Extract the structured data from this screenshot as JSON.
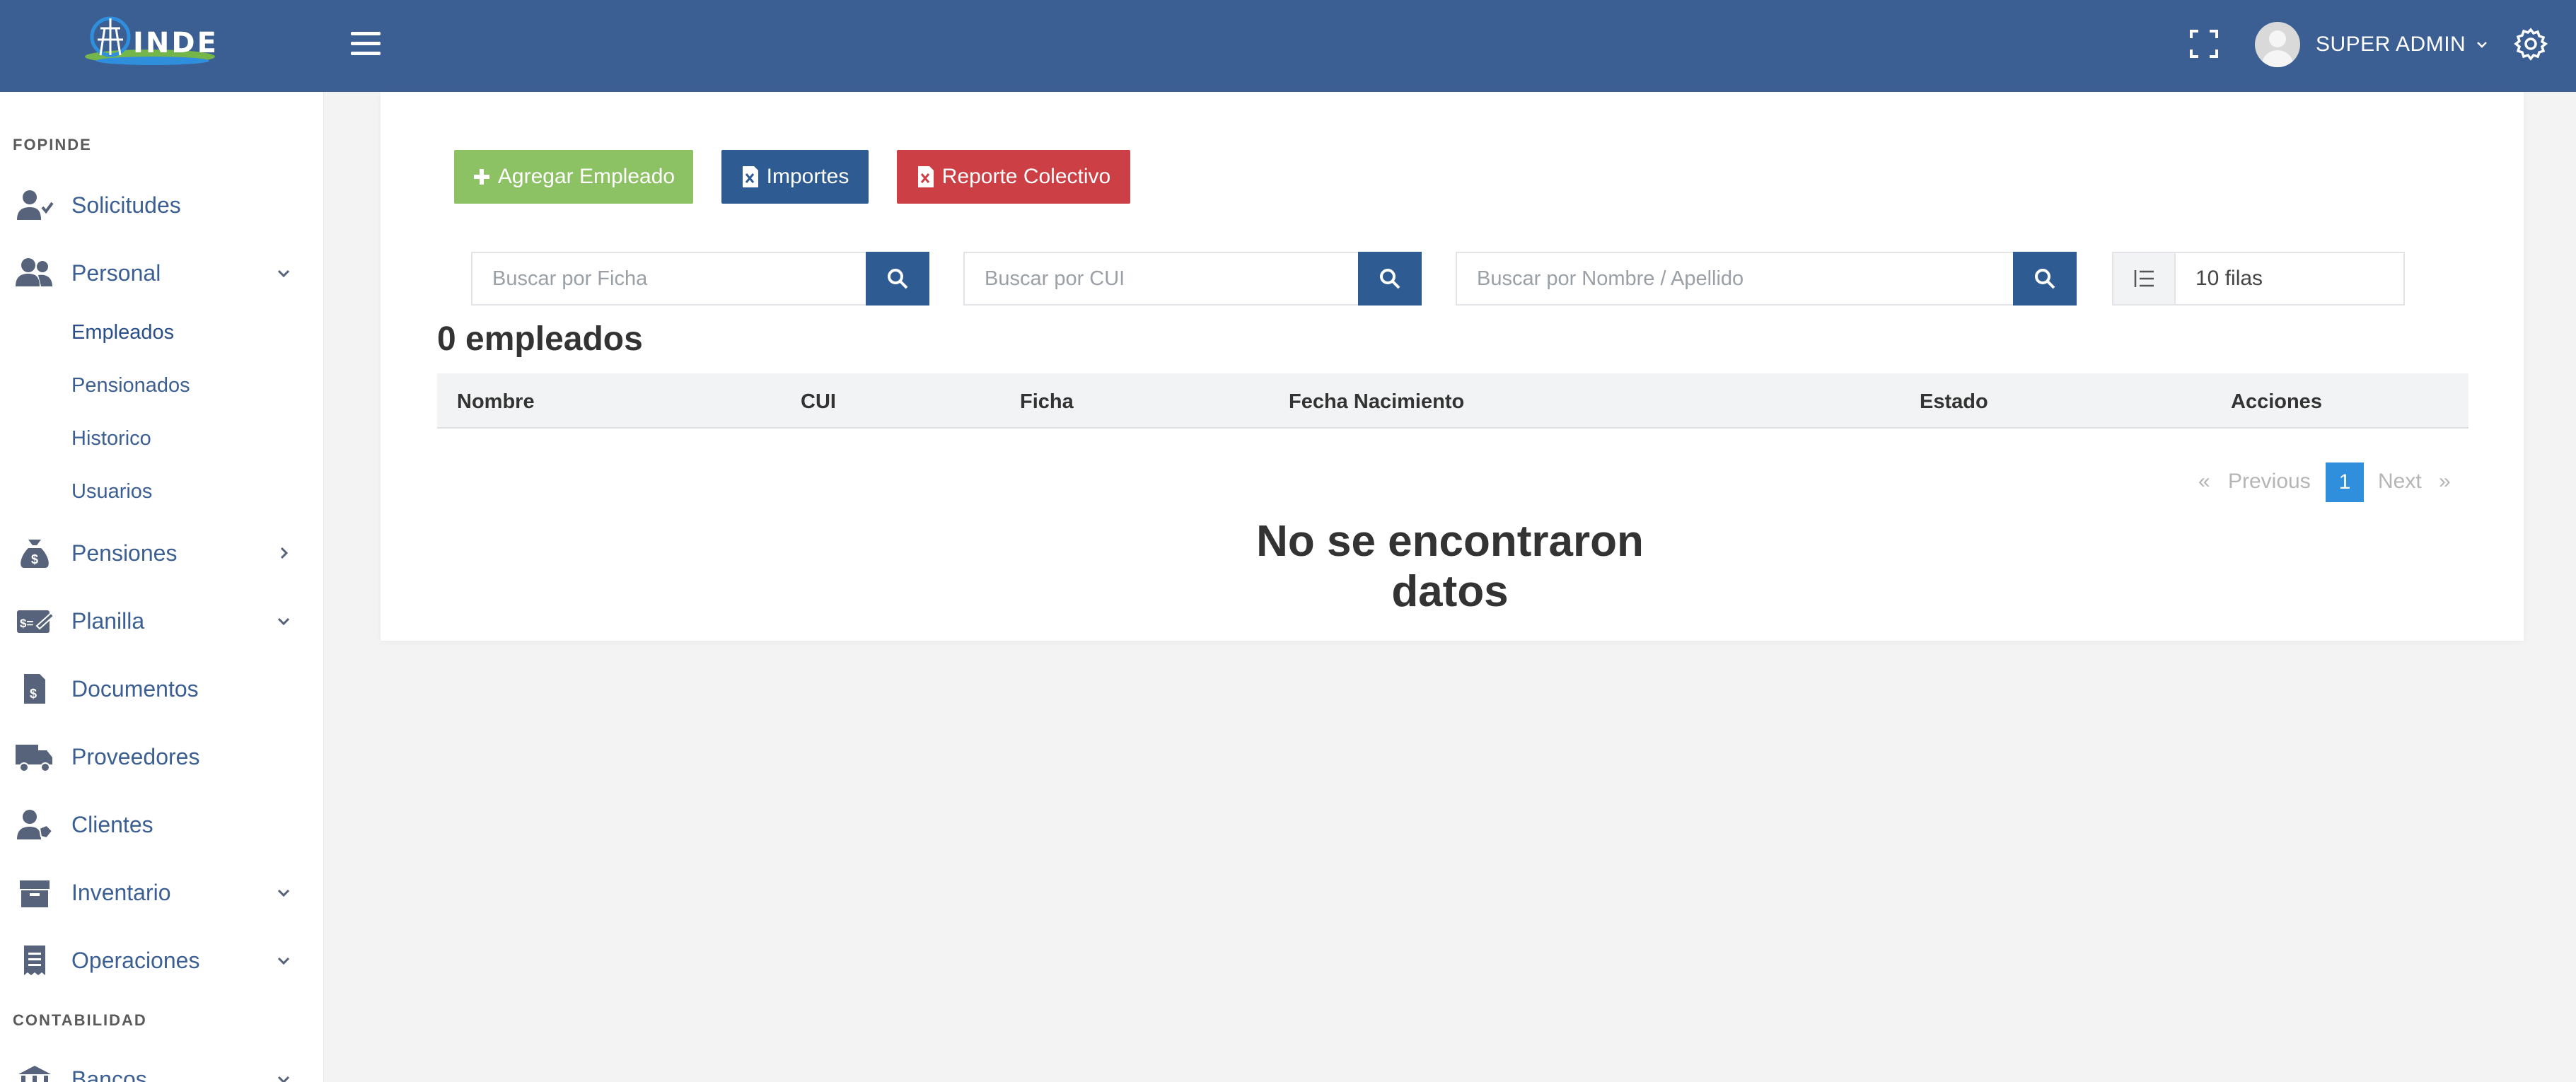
{
  "header": {
    "logo_text": "INDE",
    "user_name": "SUPER ADMIN"
  },
  "sidebar": {
    "section_1": "FOPINDE",
    "section_2": "CONTABILIDAD",
    "items": [
      {
        "label": "Solicitudes",
        "icon": "user-check-icon"
      },
      {
        "label": "Personal",
        "icon": "users-icon",
        "chevron": "down"
      },
      {
        "label": "Pensiones",
        "icon": "money-bag-icon",
        "chevron": "right"
      },
      {
        "label": "Planilla",
        "icon": "money-check-icon",
        "chevron": "down"
      },
      {
        "label": "Documentos",
        "icon": "invoice-icon"
      },
      {
        "label": "Proveedores",
        "icon": "truck-icon"
      },
      {
        "label": "Clientes",
        "icon": "user-tag-icon"
      },
      {
        "label": "Inventario",
        "icon": "box-icon",
        "chevron": "down"
      },
      {
        "label": "Operaciones",
        "icon": "receipt-icon",
        "chevron": "down"
      },
      {
        "label": "Bancos",
        "icon": "bank-icon",
        "chevron": "down"
      }
    ],
    "subitems": [
      {
        "label": "Empleados",
        "active": true
      },
      {
        "label": "Pensionados"
      },
      {
        "label": "Historico"
      },
      {
        "label": "Usuarios"
      }
    ]
  },
  "actions": {
    "add_employee": "Agregar Empleado",
    "imports": "Importes",
    "collective_report": "Reporte Colectivo"
  },
  "search": {
    "ficha_placeholder": "Buscar por Ficha",
    "cui_placeholder": "Buscar por CUI",
    "name_placeholder": "Buscar por Nombre / Apellido",
    "rows_value": "10 filas"
  },
  "table": {
    "count_label": "0 empleados",
    "columns": [
      "Nombre",
      "CUI",
      "Ficha",
      "Fecha Nacimiento",
      "Estado",
      "Acciones"
    ],
    "empty_message": "No se encontraron datos"
  },
  "pagination": {
    "first": "«",
    "previous": "Previous",
    "current": "1",
    "next": "Next",
    "last": "»"
  },
  "colors": {
    "header_bg": "#3c5f93",
    "primary": "#2e5c92",
    "success": "#8cc263",
    "danger": "#cc3f44",
    "active_page": "#2f8fdc"
  }
}
